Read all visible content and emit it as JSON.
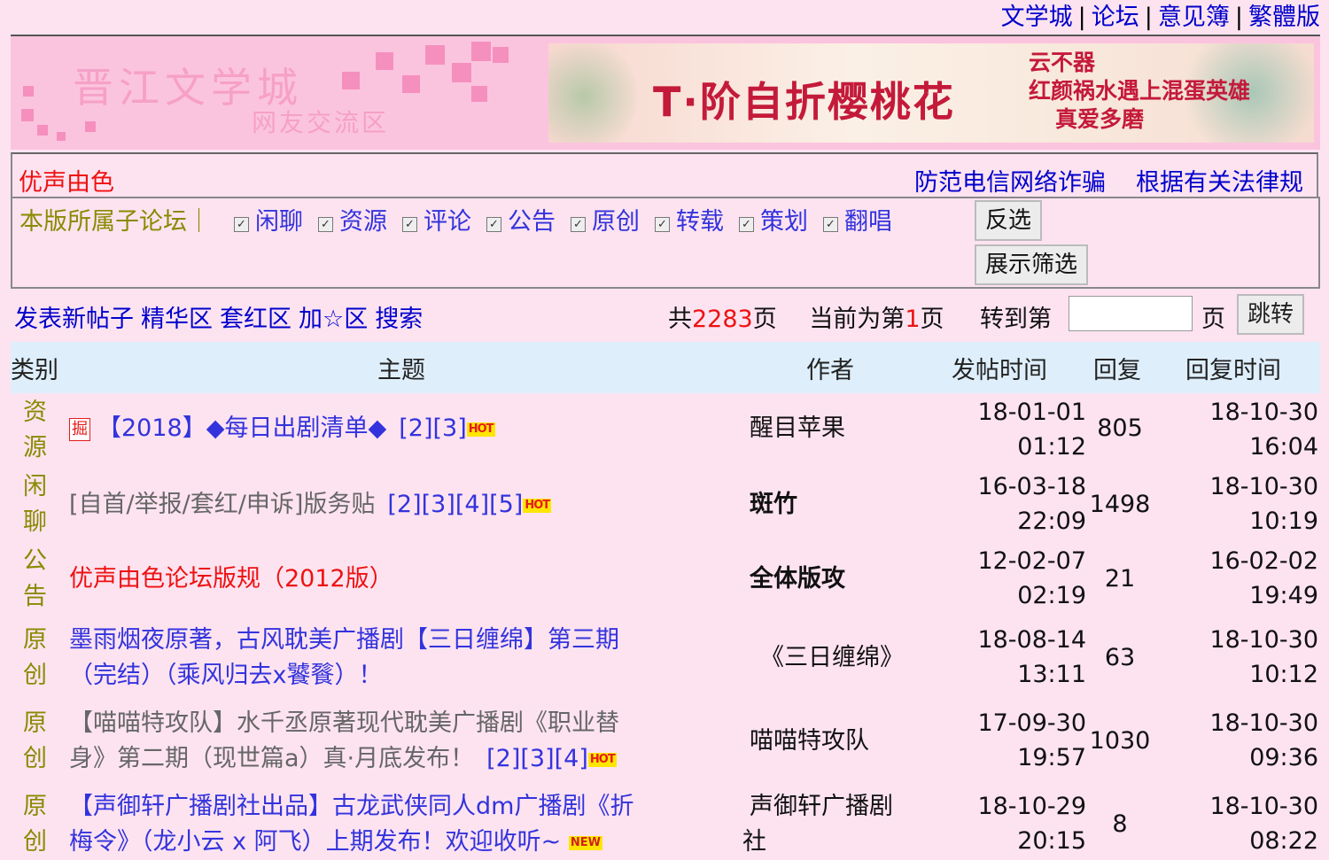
{
  "topnav": [
    "文学城",
    "论坛",
    "意见簿",
    "繁體版"
  ],
  "banner": {
    "logo_title": "晋江文学城",
    "logo_sub": "网友交流区",
    "ad_main": "T·阶自折樱桃花",
    "ad_side": [
      "云不器",
      "红颜祸水遇上混蛋英雄",
      "真爱多磨"
    ]
  },
  "notice": {
    "forum_name": "优声由色",
    "links": [
      "防范电信网络诈骗",
      "根据有关法律规"
    ]
  },
  "sub_forum": {
    "label": "本版所属子论坛｜",
    "items": [
      "闲聊",
      "资源",
      "评论",
      "公告",
      "原创",
      "转载",
      "策划",
      "翻唱"
    ],
    "invert_button": "反选",
    "filter_button": "展示筛选"
  },
  "toolbar": {
    "links": [
      "发表新帖子",
      "精华区",
      "套红区",
      "加☆区",
      "搜索"
    ],
    "total_prefix": "共",
    "total_pages": "2283",
    "total_suffix": "页",
    "current_prefix": "当前为第",
    "current_page": "1",
    "current_suffix": "页",
    "goto_label": "转到第",
    "page_unit": "页",
    "jump_button": "跳转"
  },
  "table_header": {
    "category": "类别",
    "subject": "主题",
    "author": "作者",
    "post_time": "发帖时间",
    "replies": "回复",
    "reply_time": "回复时间"
  },
  "rows": [
    {
      "cat1": "资",
      "cat2": "源",
      "tag": "掘",
      "title": "【2018】◆每日出剧清单◆",
      "pages": "[2][3]",
      "badge": "HOT",
      "author": "醒目苹果",
      "pdate": "18-01-01",
      "ptime": "01:12",
      "replies": "805",
      "rdate": "18-10-30",
      "rtime": "16:04"
    },
    {
      "cat1": "闲",
      "cat2": "聊",
      "title": "[自首/举报/套红/申诉]版务贴",
      "pages": "[2][3][4][5]",
      "badge": "HOT",
      "author": "斑竹",
      "pdate": "16-03-18",
      "ptime": "22:09",
      "replies": "1498",
      "rdate": "18-10-30",
      "rtime": "10:19"
    },
    {
      "cat1": "公",
      "cat2": "告",
      "title": "优声由色论坛版规（2012版）",
      "author": "全体版攻",
      "pdate": "12-02-07",
      "ptime": "02:19",
      "replies": "21",
      "rdate": "16-02-02",
      "rtime": "19:49"
    },
    {
      "cat1": "原",
      "cat2": "创",
      "title_line1": "墨雨烟夜原著，古风耽美广播剧【三日缠绵】第三期",
      "title_line2": "（完结）（乘风归去x饕餮）！",
      "author": "《三日缠绵》",
      "pdate": "18-08-14",
      "ptime": "13:11",
      "replies": "63",
      "rdate": "18-10-30",
      "rtime": "10:12"
    },
    {
      "cat1": "原",
      "cat2": "创",
      "title_line1": "【喵喵特攻队】水千丞原著现代耽美广播剧《职业替",
      "title_line2": "身》第二期（现世篇a）真·月底发布！",
      "pages": "[2][3][4]",
      "badge": "HOT",
      "author": "喵喵特攻队",
      "pdate": "17-09-30",
      "ptime": "19:57",
      "replies": "1030",
      "rdate": "18-10-30",
      "rtime": "09:36"
    },
    {
      "cat1": "原",
      "cat2": "创",
      "title_line1": "【声御轩广播剧社出品】古龙武侠同人dm广播剧《折",
      "title_line2": "梅令》（龙小云 x 阿飞）上期发布！欢迎收听~",
      "badge": "NEW",
      "author_line1": "声御轩广播剧",
      "author_line2": "社",
      "pdate": "18-10-29",
      "ptime": "20:15",
      "replies": "8",
      "rdate": "18-10-30",
      "rtime": "08:22"
    }
  ]
}
